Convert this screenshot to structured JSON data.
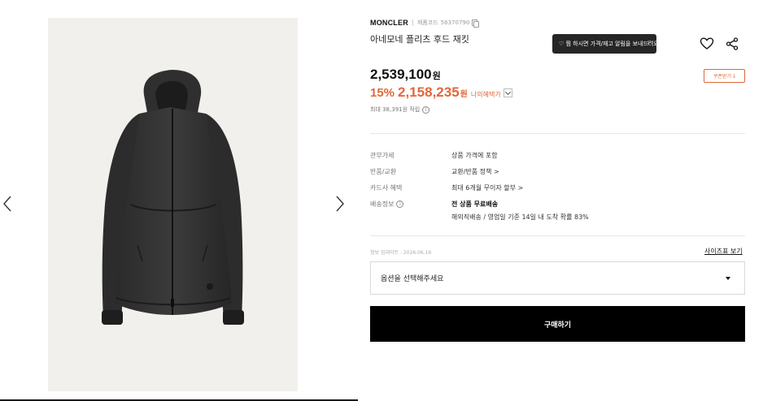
{
  "gallery": {
    "image_alt": "Black hooded zip-up jacket",
    "prev_icon": "chevron-left-icon",
    "next_icon": "chevron-right-icon",
    "background": "#f2f0ec"
  },
  "product": {
    "brand": "MONCLER",
    "code_label": "제품코드",
    "code_value": "56370790",
    "name": "아네모네 플리츠 후드 재킷"
  },
  "actions": {
    "notify_label": "♡ 찜 하시면 가격/재고 알림을 보내드려요!",
    "notify_chevron": "›",
    "coupon_label": "쿠폰받기",
    "coupon_icon": "⤓"
  },
  "price": {
    "original": "2,539,100",
    "currency": "원",
    "discount_rate": "15%",
    "discounted": "2,158,235",
    "benefit_link": "나의혜택가",
    "points": "최대 38,391원 적립",
    "points_info_icon": "i"
  },
  "specs": [
    {
      "key": "관부가세",
      "value": "상품 가격에 포함"
    },
    {
      "key": "반품/교환",
      "value": "교환/반품 정책 >"
    },
    {
      "key": "카드사 혜택",
      "value": "최대 6개월 무이자 할부 >"
    },
    {
      "key": "배송정보",
      "value": "전 상품 무료배송",
      "extra": "해외직배송 / 영업일 기준 14일 내 도착 확률 83%",
      "info_icon": "i"
    }
  ],
  "update_note": "정보 업데이트 : 2026.06.16",
  "size_chart_label": "사이즈표 보기",
  "option_placeholder": "옵션을 선택해주세요",
  "buy_label": "구매하기",
  "colors": {
    "accent": "#e2673a",
    "dark": "#262626",
    "buy": "#000000"
  }
}
